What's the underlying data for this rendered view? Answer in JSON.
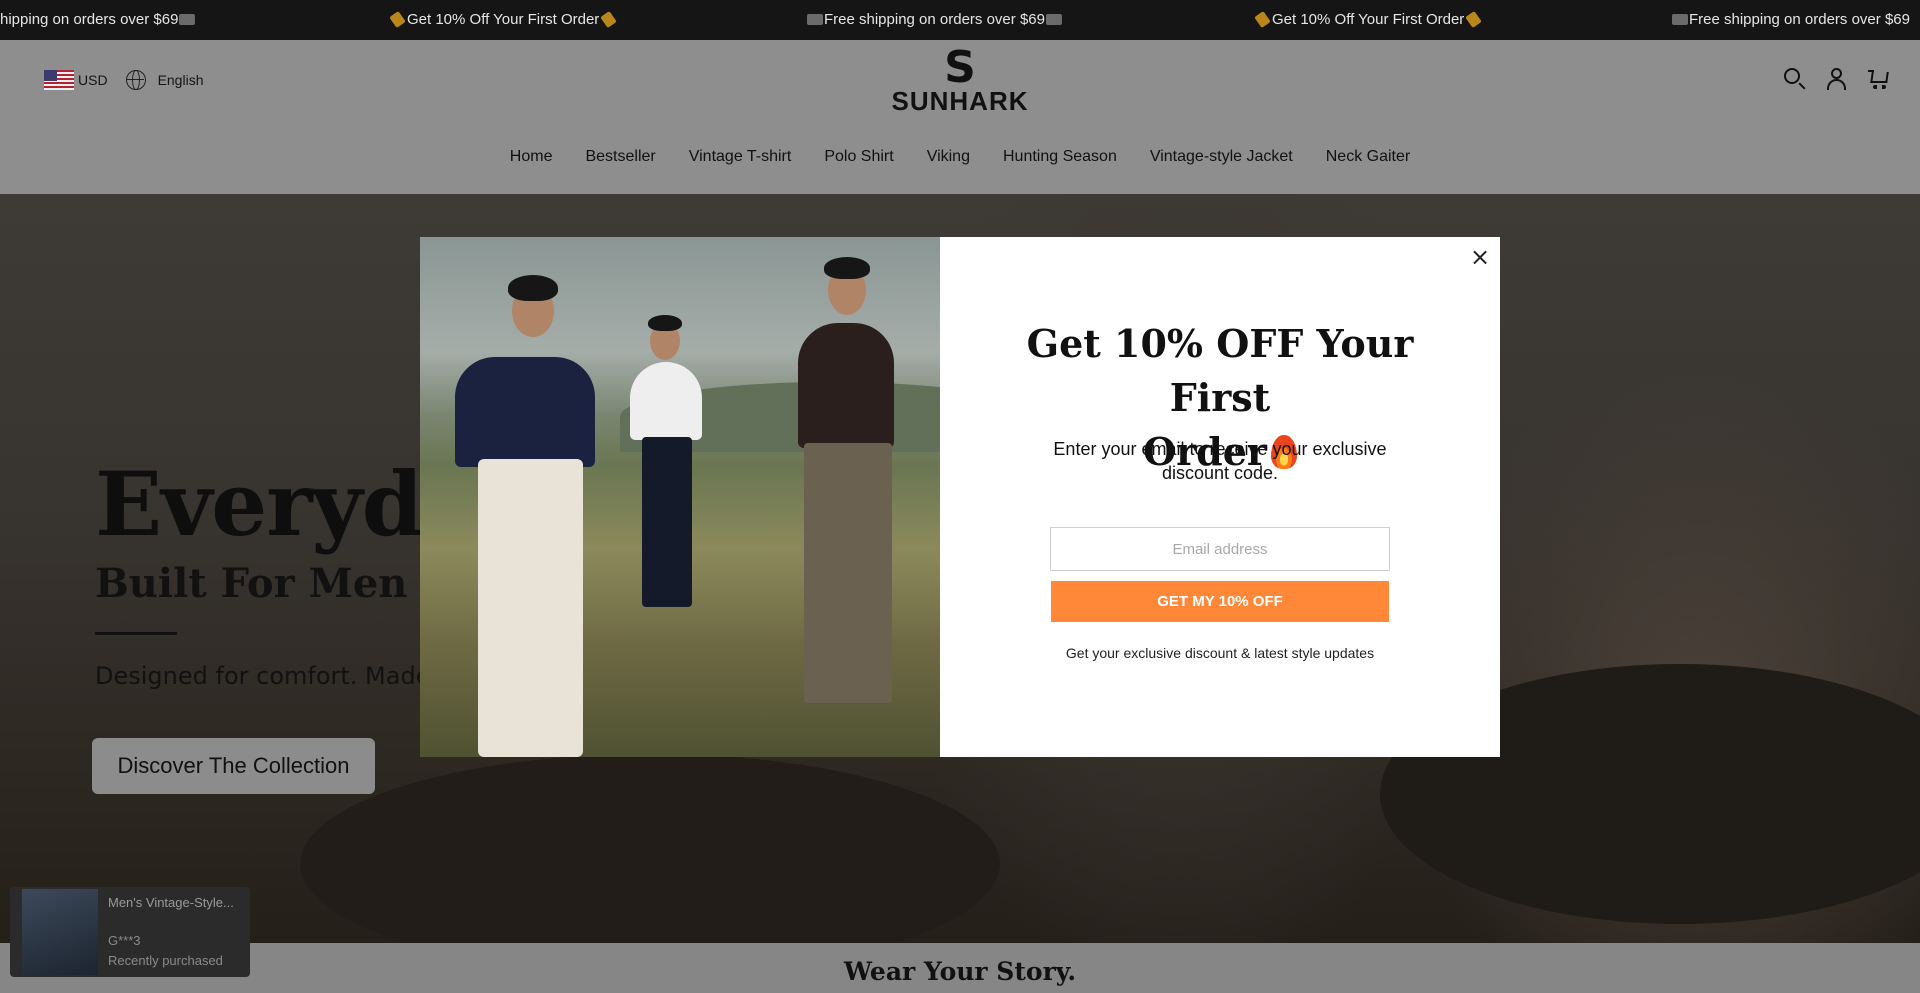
{
  "announcement": {
    "shipping": "Free shipping on orders over $69",
    "discount": "Get 10% Off Your First Order",
    "shipping_partial": "hipping on orders over $69"
  },
  "header": {
    "currency": "USD",
    "language": "English",
    "logo_mark": "S",
    "logo_text": "SUNHARK"
  },
  "nav": {
    "items": [
      "Home",
      "Bestseller",
      "Vintage T-shirt",
      "Polo Shirt",
      "Viking",
      "Hunting Season",
      "Vintage-style Jacket",
      "Neck Gaiter"
    ]
  },
  "hero": {
    "title": "Everyday",
    "subtitle": "Built For Men Who",
    "description": "Designed for comfort. Made t",
    "button": "Discover The Collection"
  },
  "story": {
    "heading": "Wear Your Story."
  },
  "toast": {
    "product": "Men's Vintage-Style...",
    "buyer": "G***3",
    "status": "Recently purchased"
  },
  "modal": {
    "heading_line1": "Get 10% OFF Your First",
    "heading_line2": "Order",
    "text": "Enter your email to receive your exclusive discount code.",
    "email_placeholder": "Email address",
    "button": "GET MY 10% OFF",
    "footer": "Get your exclusive discount & latest style updates",
    "close_symbol": "×"
  },
  "colors": {
    "accent": "#ff8838",
    "announcement_bg": "#151515"
  }
}
